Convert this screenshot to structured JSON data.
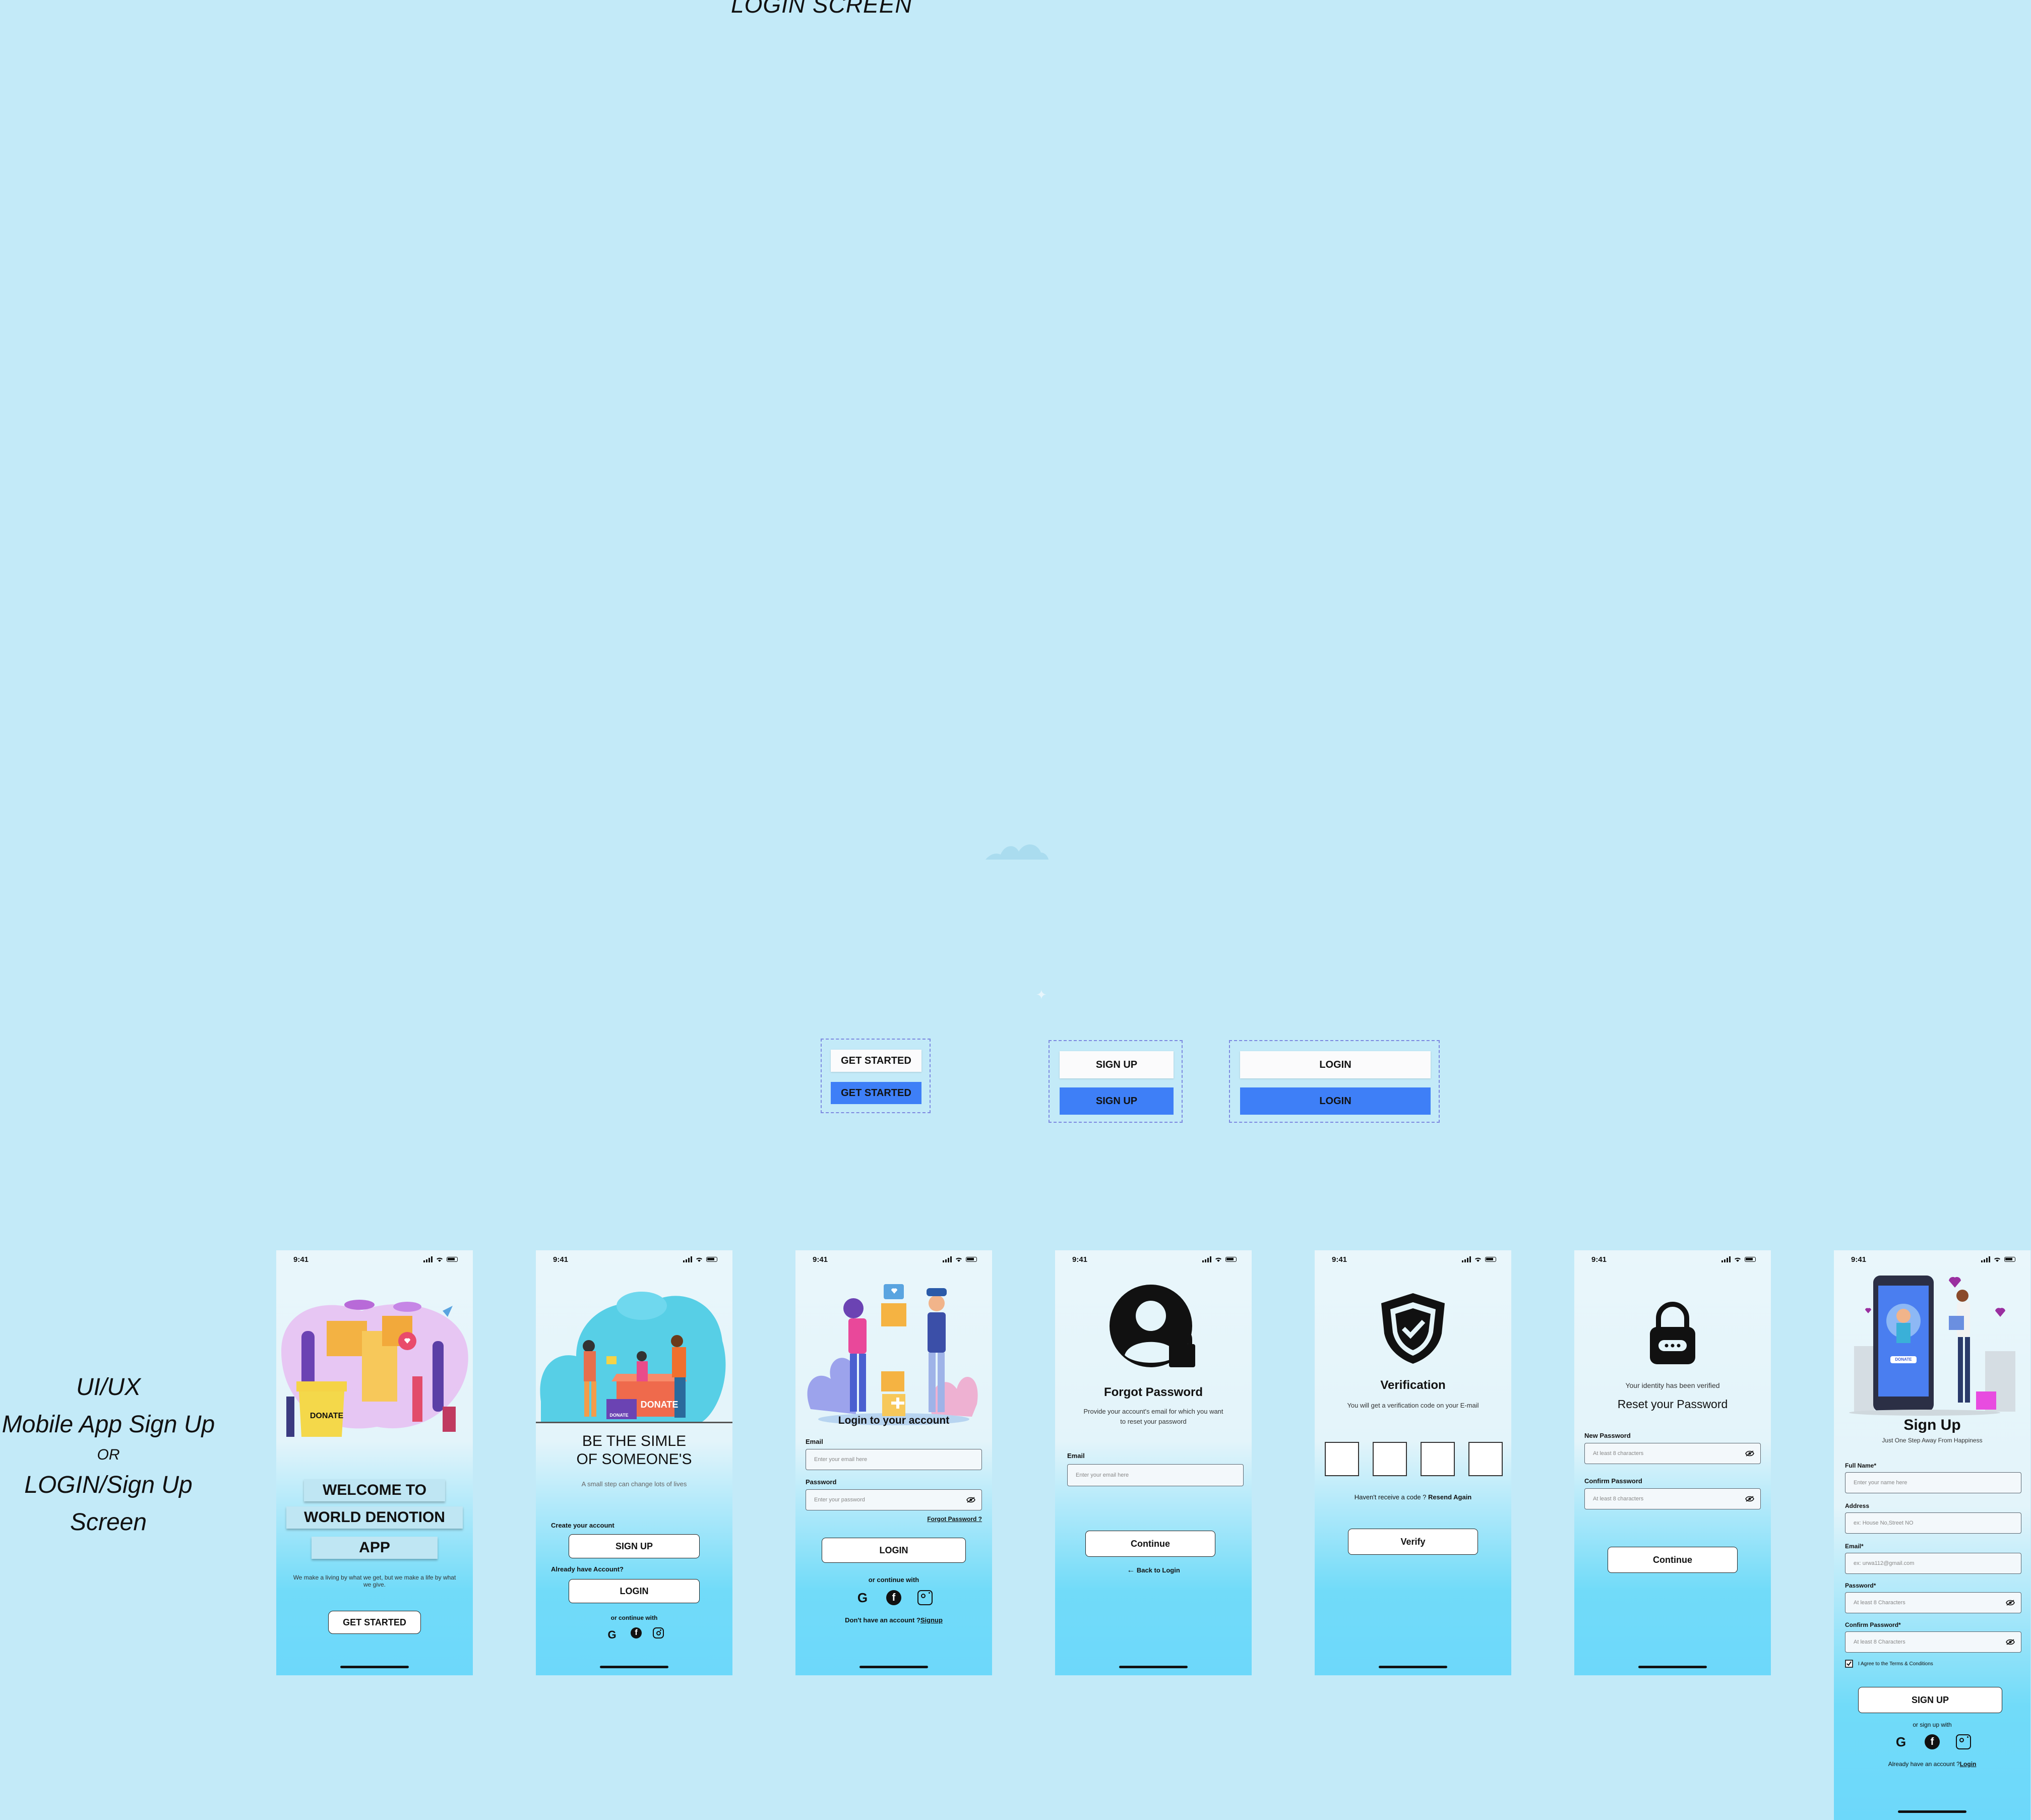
{
  "page": {
    "title": "LOGIN SCREEN",
    "side_label": {
      "line1": "UI/UX",
      "line2": "Mobile App Sign Up",
      "or": "OR",
      "line3": "LOGIN/Sign Up",
      "line4": "Screen"
    }
  },
  "components": {
    "get_started_white": "GET STARTED",
    "get_started_blue": "GET STARTED",
    "signup_white": "SIGN UP",
    "signup_blue": "SIGN UP",
    "login_white": "LOGIN",
    "login_blue": "LOGIN"
  },
  "colors": {
    "background": "#c3eaf8",
    "accent_blue": "#3e7ff7",
    "dash": "#7d89e0",
    "gradient_bottom": "#6dd8fa"
  },
  "status_time": "9:41",
  "screen1": {
    "donate_box": "DONATE",
    "welcome_line1": "WELCOME  TO",
    "welcome_line2": "WORLD DENOTION",
    "welcome_line3": "APP",
    "tagline": "We make a living by what we get, but we make a life by what we give.",
    "button": "GET STARTED"
  },
  "screen2": {
    "donate_box": "DONATE",
    "donate_small": "DONATE",
    "heading1": "BE THE SIMLE",
    "heading2": "OF SOMEONE'S",
    "subtitle": "A small step can change lots of lives",
    "create_label": "Create your account",
    "signup_button": "SIGN UP",
    "have_account_label": "Already have Account?",
    "login_button": "LOGIN",
    "continue_with": "or continue with"
  },
  "screen3": {
    "title": "Login to your account",
    "email_label": "Email",
    "email_placeholder": "Enter your email here",
    "password_label": "Password",
    "password_placeholder": "Enter your password",
    "forgot_link": "Forgot Password ?",
    "login_button": "LOGIN",
    "continue_with": "or continue with",
    "no_account": "Don't have an account ?",
    "signup_link": "Signup"
  },
  "screen4": {
    "title": "Forgot Password",
    "description": "Provide your account's email for which you want to reset your password",
    "email_label": "Email",
    "email_placeholder": "Enter your email here",
    "continue_button": "Continue",
    "back_link": "Back to Login"
  },
  "screen5": {
    "title": "Verification",
    "description": "You will get a verification code on  your E-mail",
    "not_received": "Haven't receive a code ?",
    "resend_link": "Resend Again",
    "verify_button": "Verify"
  },
  "screen6": {
    "verified_text": "Your identity has been verified",
    "title": "Reset your Password",
    "new_label": "New Password",
    "new_placeholder": "At least 8 characters",
    "confirm_label": "Confirm Password",
    "confirm_placeholder": "At least 8 characters",
    "continue_button": "Continue"
  },
  "screen7": {
    "phone_badge": "DONATE",
    "title": "Sign Up",
    "subtitle": "Just One Step Away From Happiness",
    "fullname_label": "Full Name*",
    "fullname_placeholder": "Enter your name here",
    "address_label": "Address",
    "address_placeholder": "ex: House No,Street NO",
    "email_label": "Email*",
    "email_placeholder": "ex: urwa112@gmail.com",
    "password_label": "Password*",
    "password_placeholder": "At least 8 Characters",
    "confirm_label": "Confirm Password*",
    "confirm_placeholder": "At least 8 Characters",
    "terms": "I Agree to the Terms & Conditions",
    "signup_button": "SIGN UP",
    "signup_with": "or sign up with",
    "have_account": "Already have an account ?",
    "login_link": "Login"
  },
  "icons": [
    "google-icon",
    "facebook-icon",
    "instagram-icon",
    "eye-off-icon",
    "user-lock-icon",
    "shield-check-icon",
    "padlock-icon",
    "arrow-left-icon",
    "checkbox-checked-icon",
    "signal-icon",
    "wifi-icon",
    "battery-icon"
  ]
}
